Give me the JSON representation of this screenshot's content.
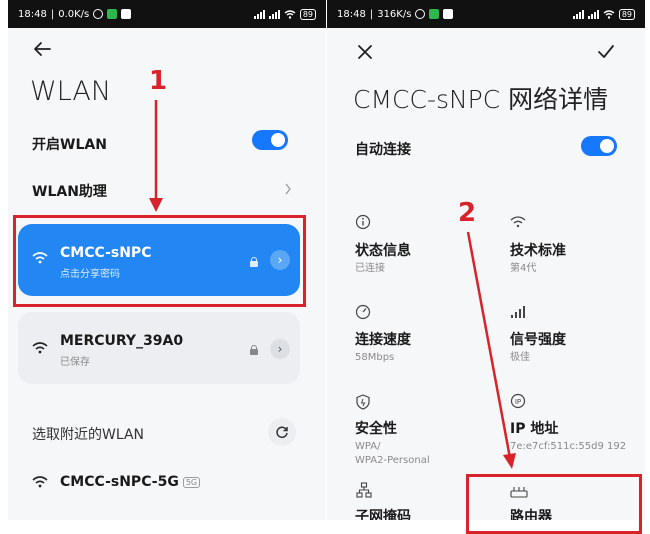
{
  "left": {
    "status": {
      "time": "18:48",
      "speed": "0.0K/s",
      "battery": "89"
    },
    "title": "WLAN",
    "enable_wlan_label": "开启WLAN",
    "wlan_assistant_label": "WLAN助理",
    "networks_connected": [
      {
        "name": "CMCC-sNPC",
        "sub": "点击分享密码"
      },
      {
        "name": "MERCURY_39A0",
        "sub": "已保存"
      }
    ],
    "nearby_label": "选取附近的WLAN",
    "nearby": [
      {
        "name": "CMCC-sNPC-5G",
        "badge": "5G"
      }
    ],
    "annotation": "1"
  },
  "right": {
    "status": {
      "time": "18:48",
      "speed": "316K/s",
      "battery": "89"
    },
    "title": "CMCC-sNPC 网络详情",
    "auto_connect_label": "自动连接",
    "annotation": "2",
    "details": {
      "status_info": {
        "label": "状态信息",
        "value": "已连接"
      },
      "tech_standard": {
        "label": "技术标准",
        "value": "第4代"
      },
      "link_speed": {
        "label": "连接速度",
        "value": "58Mbps"
      },
      "signal_strength": {
        "label": "信号强度",
        "value": "极佳"
      },
      "security": {
        "label": "安全性",
        "value": "WPA/\nWPA2-Personal"
      },
      "ip_address": {
        "label": "IP 地址",
        "value": "7e:e7cf:511c:55d9 192"
      },
      "subnet_mask": {
        "label": "子网掩码"
      },
      "router": {
        "label": "路由器"
      }
    }
  },
  "colors": {
    "accent": "#2287f2",
    "annotation": "#d9232a"
  }
}
